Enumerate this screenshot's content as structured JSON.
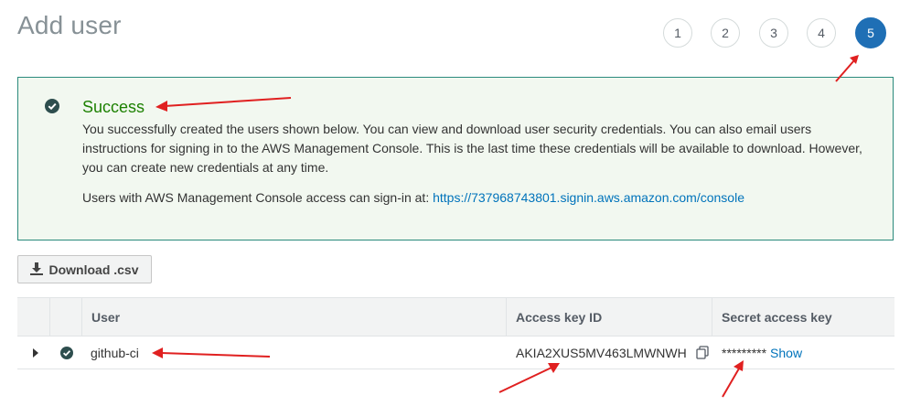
{
  "page": {
    "title": "Add user"
  },
  "steps": [
    "1",
    "2",
    "3",
    "4",
    "5"
  ],
  "alert": {
    "heading": "Success",
    "body": "You successfully created the users shown below. You can view and download user security credentials. You can also email users instructions for signing in to the AWS Management Console. This is the last time these credentials will be available to download. However, you can create new credentials at any time.",
    "signin_prefix": "Users with AWS Management Console access can sign-in at: ",
    "signin_url": "https://737968743801.signin.aws.amazon.com/console"
  },
  "toolbar": {
    "download_label": "Download .csv"
  },
  "table": {
    "columns": {
      "user": "User",
      "access_key": "Access key ID",
      "secret_key": "Secret access key"
    },
    "rows": [
      {
        "user": "github-ci",
        "access_key_id": "AKIA2XUS5MV463LMWNWH",
        "secret_masked": "*********",
        "show_label": "Show"
      }
    ]
  },
  "colors": {
    "accent": "#1f6fb5",
    "success_border": "#2a8a7c",
    "annotation": "#e02020",
    "link": "#0073bb"
  }
}
